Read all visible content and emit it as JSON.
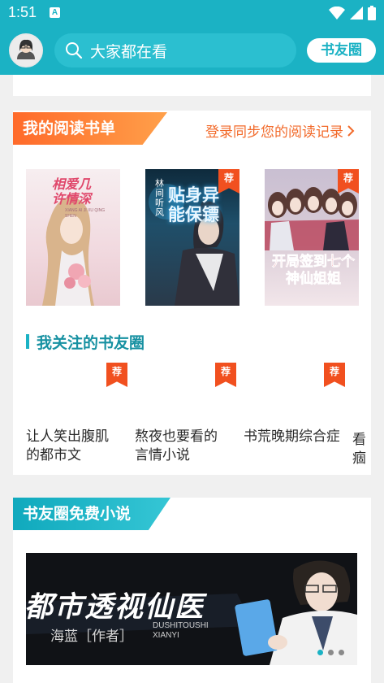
{
  "status_bar": {
    "time": "1:51",
    "notification": "A"
  },
  "header": {
    "search_placeholder": "大家都在看",
    "friends_button": "书友圈"
  },
  "reading_list": {
    "title": "我的阅读书单",
    "login_link": "登录同步您的阅读记录",
    "books": [
      {
        "cover_title": "相爱几许情深",
        "pinyin": "XIANG AI JI XU QING SHEN",
        "recommended": false
      },
      {
        "cover_title": "贴身异能保镖",
        "author_line": "林间听风",
        "recommended": true,
        "badge": "荐"
      },
      {
        "cover_title": "开局签到七个神仙姐姐",
        "recommended": true,
        "badge": "荐"
      }
    ]
  },
  "followed_circles": {
    "title": "我关注的书友圈",
    "items": [
      {
        "name": "让人笑出腹肌的都市文",
        "badge": "荐"
      },
      {
        "name": "熬夜也要看的言情小说",
        "badge": "荐"
      },
      {
        "name": "书荒晚期综合症的特效药…",
        "badge": "荐"
      }
    ],
    "overflow_chars": [
      "看",
      "痼"
    ]
  },
  "free_novels": {
    "title": "书友圈免费小说",
    "banner": {
      "title": "都市透视仙医",
      "author": "海蓝［作者］",
      "pinyin": "DUSHITOUSHI XIANYI",
      "dots": 3,
      "active_dot": 0
    }
  },
  "colors": {
    "teal": "#1bb2c4",
    "orange": "#f26a2a",
    "badge_red": "#f1501f"
  }
}
